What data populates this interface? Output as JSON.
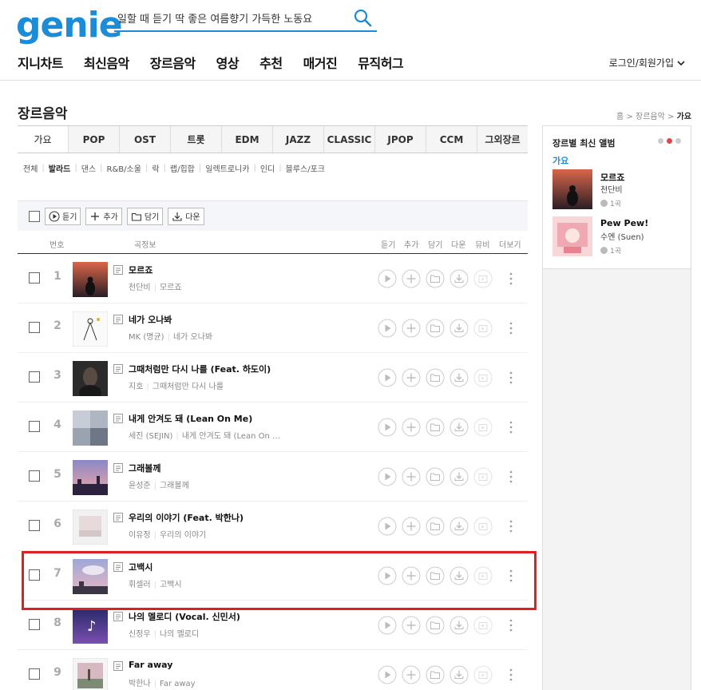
{
  "brand": {
    "logo": "genie",
    "accent": "#1a8cd8",
    "highlight": "#e02020"
  },
  "search": {
    "value": "일할 때 듣기 딱 좋은 여름향기 가득한 노동요"
  },
  "nav": [
    "지니차트",
    "최신음악",
    "장르음악",
    "영상",
    "추천",
    "매거진",
    "뮤직허그"
  ],
  "login_label": "로그인/회원가입",
  "page_title": "장르음악",
  "breadcrumb": {
    "home": "홈",
    "genre": "장르음악",
    "current": "가요",
    "sep": ">"
  },
  "genre_tabs": [
    "가요",
    "POP",
    "OST",
    "트롯",
    "EDM",
    "JAZZ",
    "CLASSIC",
    "JPOP",
    "CCM",
    "그외장르"
  ],
  "subgenres": [
    "전체",
    "발라드",
    "댄스",
    "R&B/소울",
    "락",
    "랩/힙합",
    "일렉트로니카",
    "인디",
    "블루스/포크"
  ],
  "subgenre_active": "발라드",
  "toolbar": {
    "listen": "듣기",
    "add": "추가",
    "save": "담기",
    "download": "다운"
  },
  "columns": {
    "num": "번호",
    "info": "곡정보",
    "listen": "듣기",
    "add": "추가",
    "save": "담기",
    "download": "다운",
    "mv": "뮤비",
    "more": "더보기"
  },
  "songs": [
    {
      "num": "1",
      "title": "모르죠",
      "artist": "천단비",
      "album": "모르죠"
    },
    {
      "num": "2",
      "title": "네가 오나봐",
      "artist": "MK (명균)",
      "album": "네가 오나봐"
    },
    {
      "num": "3",
      "title": "그때처럼만 다시 나를 (Feat. 하도이)",
      "artist": "지호",
      "album": "그때처럼만 다시 나를"
    },
    {
      "num": "4",
      "title": "내게 안겨도 돼 (Lean On Me)",
      "artist": "세진 (SEJIN)",
      "album": "내게 안겨도 돼 (Lean On …"
    },
    {
      "num": "5",
      "title": "그래볼께",
      "artist": "윤성준",
      "album": "그래볼께"
    },
    {
      "num": "6",
      "title": "우리의 이야기 (Feat. 박한나)",
      "artist": "이유정",
      "album": "우리의 이야기"
    },
    {
      "num": "7",
      "title": "고백시",
      "artist": "휘셀러",
      "album": "고백시"
    },
    {
      "num": "8",
      "title": "나의 멜로디 (Vocal. 신민서)",
      "artist": "신정우",
      "album": "나의 멜로디"
    },
    {
      "num": "9",
      "title": "Far away",
      "artist": "박한나",
      "album": "Far away"
    }
  ],
  "right_panel": {
    "title": "장르별 최신 앨범",
    "tab": "가요",
    "albums": [
      {
        "title": "모르죠",
        "artist": "천단비",
        "count": "1곡"
      },
      {
        "title": "Pew Pew!",
        "artist": "수엔 (Suen)",
        "count": "1곡"
      }
    ]
  }
}
